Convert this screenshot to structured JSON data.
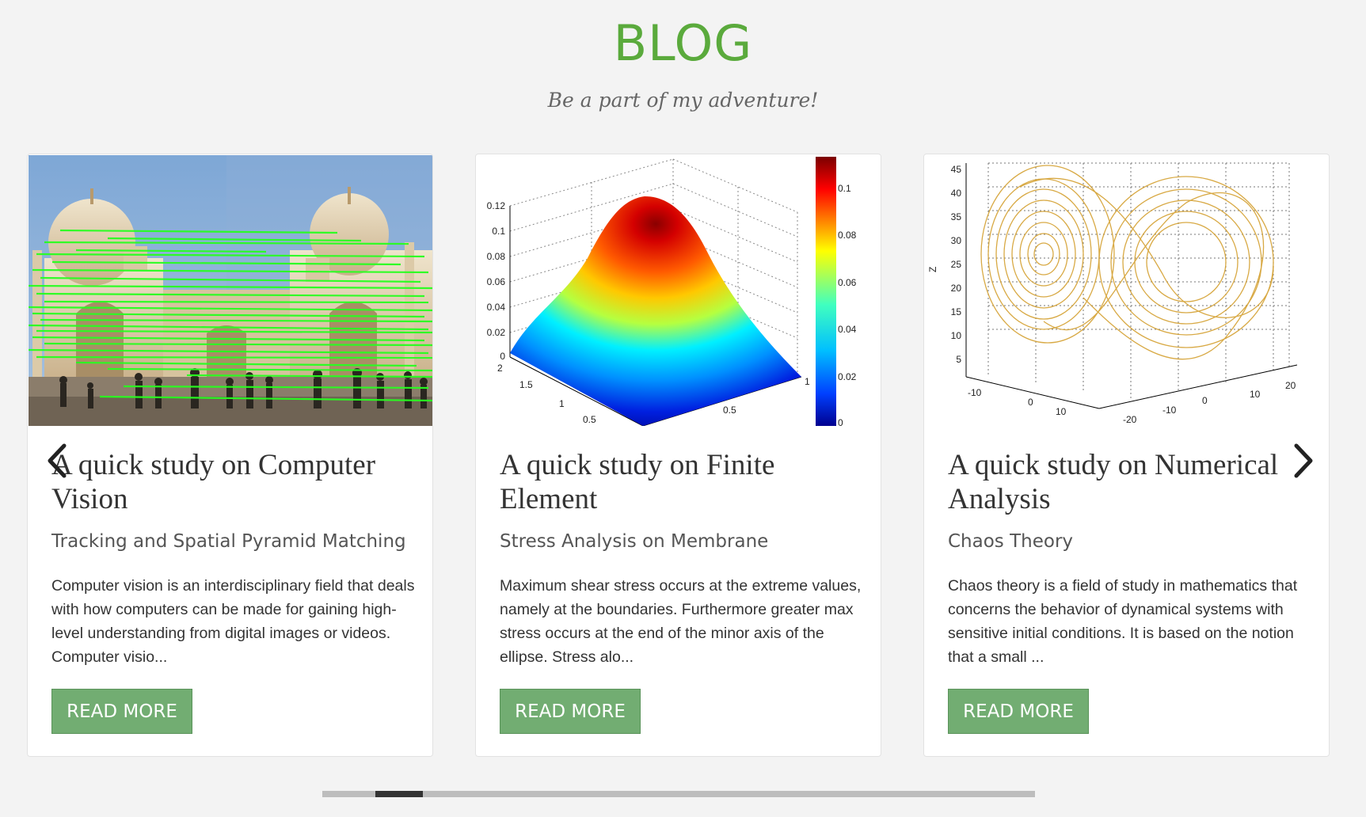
{
  "header": {
    "title": "BLOG",
    "subtitle": "Be a part of my adventure!"
  },
  "colors": {
    "accent": "#5aaa3c",
    "button": "#72ad72"
  },
  "posts": [
    {
      "title": "A quick study on Computer Vision",
      "subtitle": "Tracking and Spatial Pyramid Matching",
      "excerpt": "Computer vision is an interdisciplinary field that deals with how computers can be made for gaining high-level understanding from digital images or videos. Computer visio...",
      "button": "READ MORE",
      "image": "taj-mahal-feature-matching-photo"
    },
    {
      "title": "A quick study on Finite Element",
      "subtitle": "Stress Analysis on Membrane",
      "excerpt": "Maximum shear stress occurs at the extreme values, namely at the boundaries. Furthermore greater max stress occurs at the end of the minor axis of the ellipse. Stress alo...",
      "button": "READ MORE",
      "image": "3d-stress-surface-plot",
      "plot": {
        "z_ticks": [
          "0",
          "0.02",
          "0.04",
          "0.06",
          "0.08",
          "0.1",
          "0.12"
        ],
        "x_ticks": [
          "2",
          "1.5",
          "1",
          "0.5"
        ],
        "y_ticks": [
          "0.5",
          "1"
        ],
        "colorbar_ticks": [
          "0.1",
          "0.08",
          "0.06",
          "0.04",
          "0.02",
          "0"
        ]
      }
    },
    {
      "title": "A quick study on Numerical Analysis",
      "subtitle": "Chaos Theory",
      "excerpt": "Chaos theory is a field of study in mathematics that concerns the behavior of dynamical systems with sensitive initial conditions. It is based on the notion that a small ...",
      "button": "READ MORE",
      "image": "lorenz-attractor-plot",
      "plot": {
        "z_label": "Z",
        "z_ticks": [
          "45",
          "40",
          "35",
          "30",
          "25",
          "20",
          "15",
          "10",
          "5"
        ],
        "x_ticks": [
          "-10",
          "0",
          "10"
        ],
        "y_ticks": [
          "-20",
          "-10",
          "0",
          "10",
          "20"
        ]
      }
    }
  ],
  "carousel": {
    "prev_icon": "chevron-left-icon",
    "next_icon": "chevron-right-icon",
    "scroll_position": 0.08
  }
}
